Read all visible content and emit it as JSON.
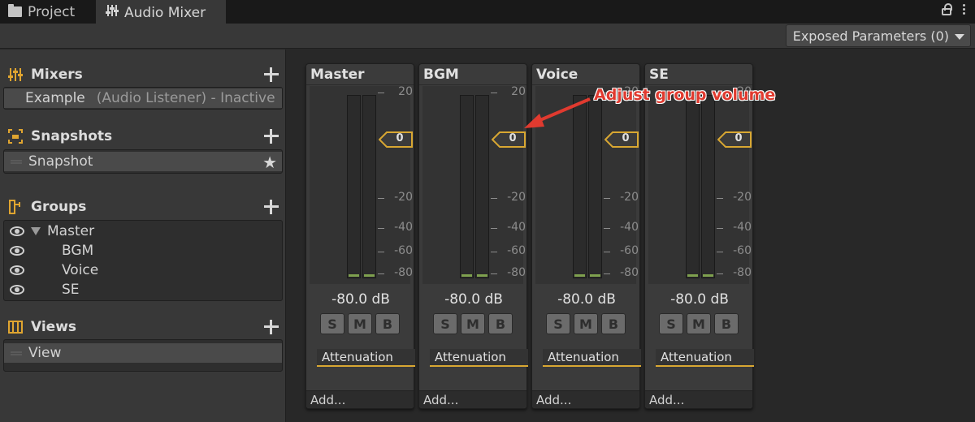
{
  "tabs": [
    {
      "label": "Project",
      "icon": "folder-icon"
    },
    {
      "label": "Audio Mixer",
      "icon": "sliders-icon"
    }
  ],
  "toolbar": {
    "exposed_parameters": "Exposed Parameters (0)"
  },
  "sidebar": {
    "mixers": {
      "title": "Mixers",
      "items": [
        {
          "name": "Example",
          "detail": "(Audio Listener) - Inactive"
        }
      ]
    },
    "snapshots": {
      "title": "Snapshots",
      "items": [
        {
          "name": "Snapshot"
        }
      ]
    },
    "groups": {
      "title": "Groups",
      "items": [
        "Master",
        "BGM",
        "Voice",
        "SE"
      ]
    },
    "views": {
      "title": "Views",
      "items": [
        {
          "name": "View"
        }
      ]
    }
  },
  "strips": [
    {
      "name": "Master",
      "fader": "0",
      "level_db": "-80.0 dB",
      "effect": "Attenuation",
      "add": "Add..."
    },
    {
      "name": "BGM",
      "fader": "0",
      "level_db": "-80.0 dB",
      "effect": "Attenuation",
      "add": "Add..."
    },
    {
      "name": "Voice",
      "fader": "0",
      "level_db": "-80.0 dB",
      "effect": "Attenuation",
      "add": "Add..."
    },
    {
      "name": "SE",
      "fader": "0",
      "level_db": "-80.0 dB",
      "effect": "Attenuation",
      "add": "Add..."
    }
  ],
  "scale_labels": [
    "20",
    "0",
    "-20",
    "-40",
    "-60",
    "-80"
  ],
  "button_labels": {
    "solo": "S",
    "mute": "M",
    "bypass": "B"
  },
  "annotation": "Adjust group volume",
  "colors": {
    "accent": "#d8a732",
    "annotation": "#e03a2f",
    "meter_level": "#7ea04e"
  }
}
